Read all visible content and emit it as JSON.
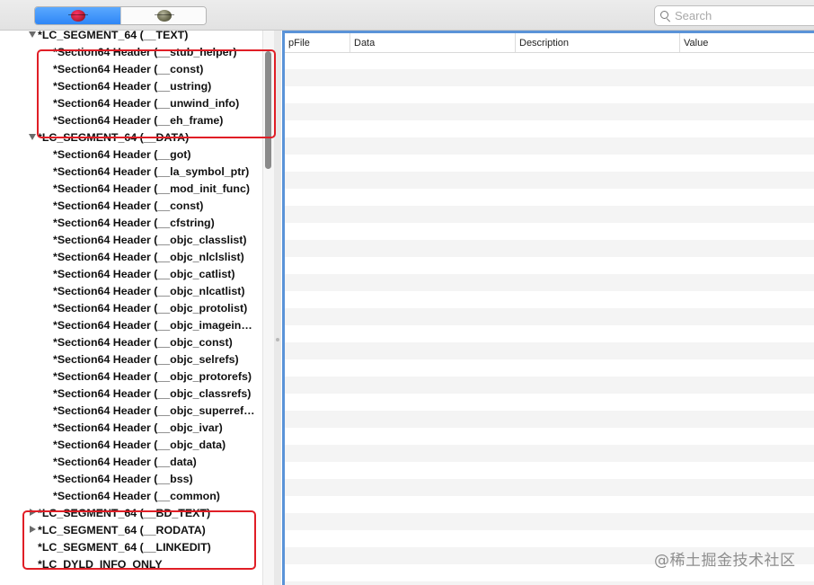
{
  "toolbar": {
    "segments": [
      {
        "icon": "bug-red-icon"
      },
      {
        "icon": "bug-grey-icon"
      }
    ],
    "search_placeholder": "Search"
  },
  "tree": {
    "rows": [
      {
        "label": "*LC_SEGMENT_64 (__TEXT)",
        "toggle": "down"
      },
      {
        "label": "*Section64 Header (__stub_helper)",
        "toggle": "none"
      },
      {
        "label": "*Section64 Header (__const)",
        "toggle": "none"
      },
      {
        "label": "*Section64 Header (__ustring)",
        "toggle": "none"
      },
      {
        "label": "*Section64 Header (__unwind_info)",
        "toggle": "none"
      },
      {
        "label": "*Section64 Header (__eh_frame)",
        "toggle": "none"
      },
      {
        "label": "*LC_SEGMENT_64 (__DATA)",
        "toggle": "down"
      },
      {
        "label": "*Section64 Header (__got)",
        "toggle": "none"
      },
      {
        "label": "*Section64 Header (__la_symbol_ptr)",
        "toggle": "none"
      },
      {
        "label": "*Section64 Header (__mod_init_func)",
        "toggle": "none"
      },
      {
        "label": "*Section64 Header (__const)",
        "toggle": "none"
      },
      {
        "label": "*Section64 Header (__cfstring)",
        "toggle": "none"
      },
      {
        "label": "*Section64 Header (__objc_classlist)",
        "toggle": "none"
      },
      {
        "label": "*Section64 Header (__objc_nlclslist)",
        "toggle": "none"
      },
      {
        "label": "*Section64 Header (__objc_catlist)",
        "toggle": "none"
      },
      {
        "label": "*Section64 Header (__objc_nlcatlist)",
        "toggle": "none"
      },
      {
        "label": "*Section64 Header (__objc_protolist)",
        "toggle": "none"
      },
      {
        "label": "*Section64 Header (__objc_imagein…",
        "toggle": "none"
      },
      {
        "label": "*Section64 Header (__objc_const)",
        "toggle": "none"
      },
      {
        "label": "*Section64 Header (__objc_selrefs)",
        "toggle": "none"
      },
      {
        "label": "*Section64 Header (__objc_protorefs)",
        "toggle": "none"
      },
      {
        "label": "*Section64 Header (__objc_classrefs)",
        "toggle": "none"
      },
      {
        "label": "*Section64 Header (__objc_superref…",
        "toggle": "none"
      },
      {
        "label": "*Section64 Header (__objc_ivar)",
        "toggle": "none"
      },
      {
        "label": "*Section64 Header (__objc_data)",
        "toggle": "none"
      },
      {
        "label": "*Section64 Header (__data)",
        "toggle": "none"
      },
      {
        "label": "*Section64 Header (__bss)",
        "toggle": "none"
      },
      {
        "label": "*Section64 Header (__common)",
        "toggle": "none"
      },
      {
        "label": "*LC_SEGMENT_64 (__BD_TEXT)",
        "toggle": "right"
      },
      {
        "label": "*LC_SEGMENT_64 (__RODATA)",
        "toggle": "right"
      },
      {
        "label": "*LC_SEGMENT_64 (__LINKEDIT)",
        "toggle": "none"
      },
      {
        "label": "*LC_DYLD_INFO_ONLY",
        "toggle": "none"
      }
    ]
  },
  "table": {
    "columns": [
      "pFile",
      "Data",
      "Description",
      "Value"
    ]
  },
  "watermark": "@稀土掘金技术社区",
  "colors": {
    "accent_blue": "#5a93d8",
    "annotation_red": "#e01e26",
    "stripe": "#f4f4f4"
  }
}
